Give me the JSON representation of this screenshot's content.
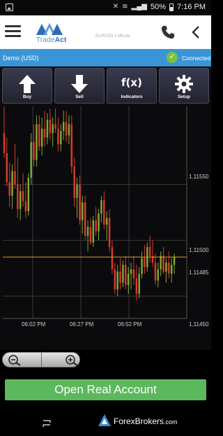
{
  "status_bar": {
    "battery": "50%",
    "time": "7:16 PM"
  },
  "header": {
    "logo_text_prefix": "Trade",
    "logo_text_suffix": "Act",
    "symbol_label": "EURUSD 1 Minute"
  },
  "connection": {
    "account": "Demo (USD)",
    "status": "Connected"
  },
  "toolbar": {
    "buttons": [
      {
        "label": "Buy",
        "icon": "arrow-up-icon"
      },
      {
        "label": "Sell",
        "icon": "arrow-down-icon"
      },
      {
        "label": "Indicators",
        "icon": "fx-icon",
        "glyph": "f(x)"
      },
      {
        "label": "Setup",
        "icon": "gear-icon"
      }
    ]
  },
  "chart_data": {
    "type": "candlestick",
    "symbol": "EURUSD",
    "timeframe": "1 Minute",
    "y_ticks": [
      "1.11550",
      "1.11500",
      "1.11485",
      "1.11450"
    ],
    "x_ticks": [
      "06:02 PM",
      "06:27 PM",
      "06:52 PM"
    ],
    "current_price": "1.11485",
    "ylim": [
      1.1143,
      1.1162
    ],
    "colors": {
      "up": "#7dab32",
      "down": "#d93a2b",
      "price_line": "#d9a21b",
      "grid": "#3a3a3a"
    },
    "ohlc": [
      [
        1.11596,
        1.1162,
        1.11574,
        1.11578
      ],
      [
        1.11578,
        1.11592,
        1.11548,
        1.11552
      ],
      [
        1.11552,
        1.1157,
        1.1153,
        1.1154
      ],
      [
        1.1154,
        1.11568,
        1.11528,
        1.11562
      ],
      [
        1.11562,
        1.11586,
        1.11546,
        1.1155
      ],
      [
        1.1155,
        1.11574,
        1.1152,
        1.11528
      ],
      [
        1.11528,
        1.1155,
        1.11518,
        1.11544
      ],
      [
        1.11544,
        1.1156,
        1.1153,
        1.11535
      ],
      [
        1.11535,
        1.11552,
        1.1152,
        1.11526
      ],
      [
        1.11526,
        1.1156,
        1.11522,
        1.11556
      ],
      [
        1.11556,
        1.11596,
        1.1155,
        1.11588
      ],
      [
        1.11588,
        1.11604,
        1.11566,
        1.11572
      ],
      [
        1.11572,
        1.11612,
        1.11566,
        1.11604
      ],
      [
        1.11604,
        1.11612,
        1.1158,
        1.11584
      ],
      [
        1.11584,
        1.1161,
        1.11576,
        1.116
      ],
      [
        1.116,
        1.11616,
        1.11584,
        1.11592
      ],
      [
        1.11592,
        1.11614,
        1.11586,
        1.11608
      ],
      [
        1.11608,
        1.11618,
        1.1159,
        1.11596
      ],
      [
        1.11596,
        1.1161,
        1.11584,
        1.11604
      ],
      [
        1.11604,
        1.11618,
        1.11596,
        1.116
      ],
      [
        1.116,
        1.1161,
        1.1158,
        1.11586
      ],
      [
        1.11586,
        1.11604,
        1.1158,
        1.11598
      ],
      [
        1.11598,
        1.11616,
        1.1159,
        1.11606
      ],
      [
        1.11606,
        1.11616,
        1.11588,
        1.11594
      ],
      [
        1.11594,
        1.11612,
        1.11586,
        1.11604
      ],
      [
        1.11604,
        1.11612,
        1.1156,
        1.11566
      ],
      [
        1.11566,
        1.11574,
        1.1153,
        1.11538
      ],
      [
        1.11538,
        1.11556,
        1.1152,
        1.1155
      ],
      [
        1.1155,
        1.11558,
        1.11514,
        1.11518
      ],
      [
        1.11518,
        1.1154,
        1.11506,
        1.11534
      ],
      [
        1.11534,
        1.1154,
        1.115,
        1.11504
      ],
      [
        1.11504,
        1.11518,
        1.1149,
        1.11512
      ],
      [
        1.11512,
        1.1152,
        1.11496,
        1.11498
      ],
      [
        1.11498,
        1.11522,
        1.11494,
        1.11518
      ],
      [
        1.11518,
        1.1153,
        1.11504,
        1.11508
      ],
      [
        1.11508,
        1.11528,
        1.115,
        1.11524
      ],
      [
        1.11524,
        1.1154,
        1.11516,
        1.11536
      ],
      [
        1.11536,
        1.11544,
        1.1151,
        1.11514
      ],
      [
        1.11514,
        1.11526,
        1.115,
        1.1152
      ],
      [
        1.1152,
        1.11528,
        1.1149,
        1.11494
      ],
      [
        1.11494,
        1.115,
        1.1147,
        1.11474
      ],
      [
        1.11474,
        1.1148,
        1.11452,
        1.11456
      ],
      [
        1.11456,
        1.11478,
        1.1145,
        1.11472
      ],
      [
        1.11472,
        1.11484,
        1.11456,
        1.11462
      ],
      [
        1.11462,
        1.11482,
        1.11458,
        1.11478
      ],
      [
        1.11478,
        1.11486,
        1.11456,
        1.1146
      ],
      [
        1.1146,
        1.11476,
        1.11452,
        1.1147
      ],
      [
        1.1147,
        1.1148,
        1.11456,
        1.11474
      ],
      [
        1.11474,
        1.11486,
        1.1146,
        1.11466
      ],
      [
        1.11466,
        1.11478,
        1.11446,
        1.11452
      ],
      [
        1.11452,
        1.11476,
        1.11448,
        1.1147
      ],
      [
        1.1147,
        1.1149,
        1.11466,
        1.11484
      ],
      [
        1.11484,
        1.11496,
        1.1147,
        1.11476
      ],
      [
        1.11476,
        1.11498,
        1.11472,
        1.11494
      ],
      [
        1.11494,
        1.11504,
        1.1148,
        1.11486
      ],
      [
        1.11486,
        1.115,
        1.11476,
        1.1148
      ],
      [
        1.1148,
        1.11488,
        1.1146,
        1.11464
      ],
      [
        1.11464,
        1.1148,
        1.11458,
        1.11474
      ],
      [
        1.11474,
        1.1149,
        1.11468,
        1.11486
      ],
      [
        1.11486,
        1.11494,
        1.1147,
        1.11472
      ],
      [
        1.11472,
        1.11484,
        1.11462,
        1.1148
      ],
      [
        1.1148,
        1.1149,
        1.11466,
        1.1147
      ],
      [
        1.1147,
        1.11484,
        1.11462,
        1.11478
      ],
      [
        1.11478,
        1.11488,
        1.1147,
        1.11485
      ]
    ]
  },
  "cta": {
    "label": "Open Real Account"
  },
  "watermark": {
    "text": "ForexBrokers",
    "suffix": ".com"
  }
}
